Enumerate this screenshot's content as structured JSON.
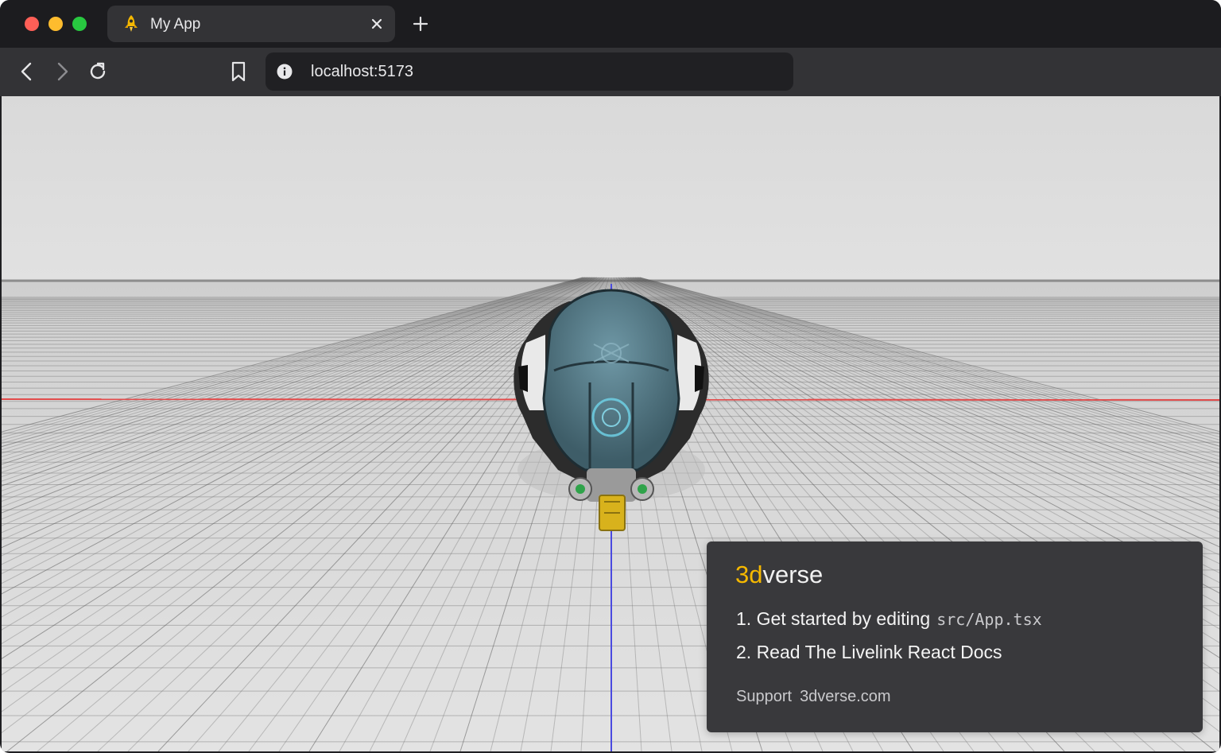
{
  "browser": {
    "tab": {
      "title": "My App",
      "favicon": "rocket-icon"
    },
    "address_bar": {
      "url": "localhost:5173"
    },
    "icons": {
      "back": "chevron-left-icon",
      "forward": "chevron-right-icon",
      "reload": "reload-icon",
      "bookmark": "bookmark-icon",
      "site_info": "info-icon",
      "close_tab": "close-icon",
      "new_tab": "plus-icon"
    }
  },
  "card": {
    "brand_accent": "3d",
    "brand_rest": "verse",
    "step1_text": "1. Get started by editing",
    "step1_code": "src/App.tsx",
    "step2_text": "2. Read The Livelink React Docs",
    "support_label": "Support",
    "support_link": "3dverse.com"
  },
  "colors": {
    "accent": "#f5b800",
    "x_axis": "#e24a4a",
    "z_axis": "#4a4ae0"
  }
}
